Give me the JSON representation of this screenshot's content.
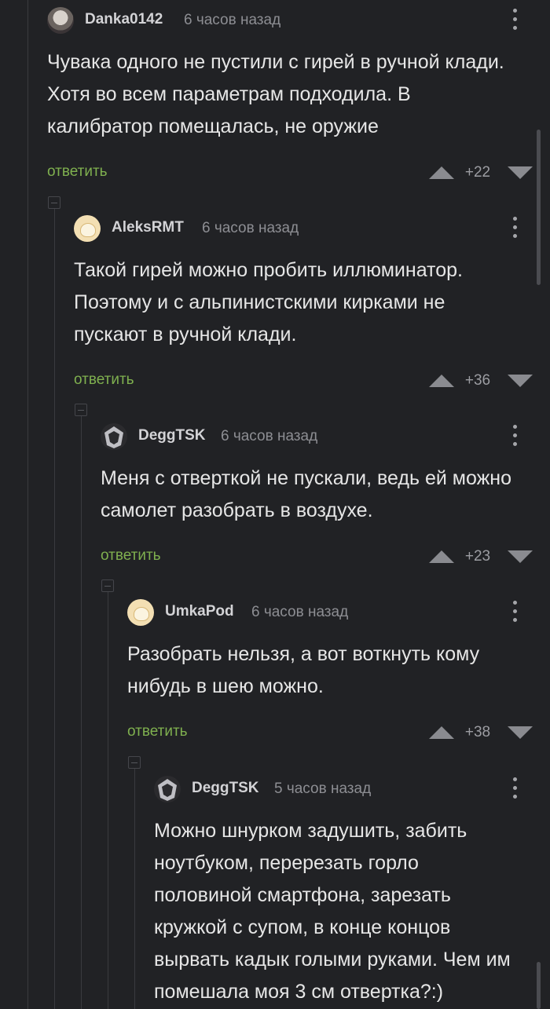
{
  "ui": {
    "reply_label": "ответить"
  },
  "comments": [
    {
      "author": "Danka0142",
      "time": "6 часов назад",
      "text": "Чувака одного не пустили с гирей в ручной клади. Хотя во всем параметрам подходила. В калибратор помещалась, не оружие",
      "score": "+22",
      "avatar_icon": "user-avatar-icon"
    },
    {
      "author": "AleksRMT",
      "time": "6 часов назад",
      "text": "Такой гирей можно пробить иллюминатор. Поэтому и с альпинистскими кирками не пускают в ручной клади.",
      "score": "+36",
      "avatar_icon": "user-avatar-icon"
    },
    {
      "author": "DeggTSK",
      "time": "6 часов назад",
      "text": "Меня с отверткой не пускали, ведь ей можно самолет разобрать в воздухе.",
      "score": "+23",
      "avatar_icon": "user-avatar-icon"
    },
    {
      "author": "UmkaPod",
      "time": "6 часов назад",
      "text": "Разобрать нельзя, а вот воткнуть кому нибудь в шею можно.",
      "score": "+38",
      "avatar_icon": "user-avatar-icon"
    },
    {
      "author": "DeggTSK",
      "time": "5 часов назад",
      "text": "Можно шнурком задушить, забить ноутбуком, перерезать горло половиной смартфона, зарезать кружкой с супом, в конце концов вырвать кадык голыми руками. Чем им помешала моя 3 см отвертка?:)",
      "score": "",
      "avatar_icon": "user-avatar-icon"
    }
  ],
  "colors": {
    "background": "#212225",
    "reply_link": "#7fb04f",
    "text": "#e6e6e6",
    "meta": "#8d8e93"
  }
}
